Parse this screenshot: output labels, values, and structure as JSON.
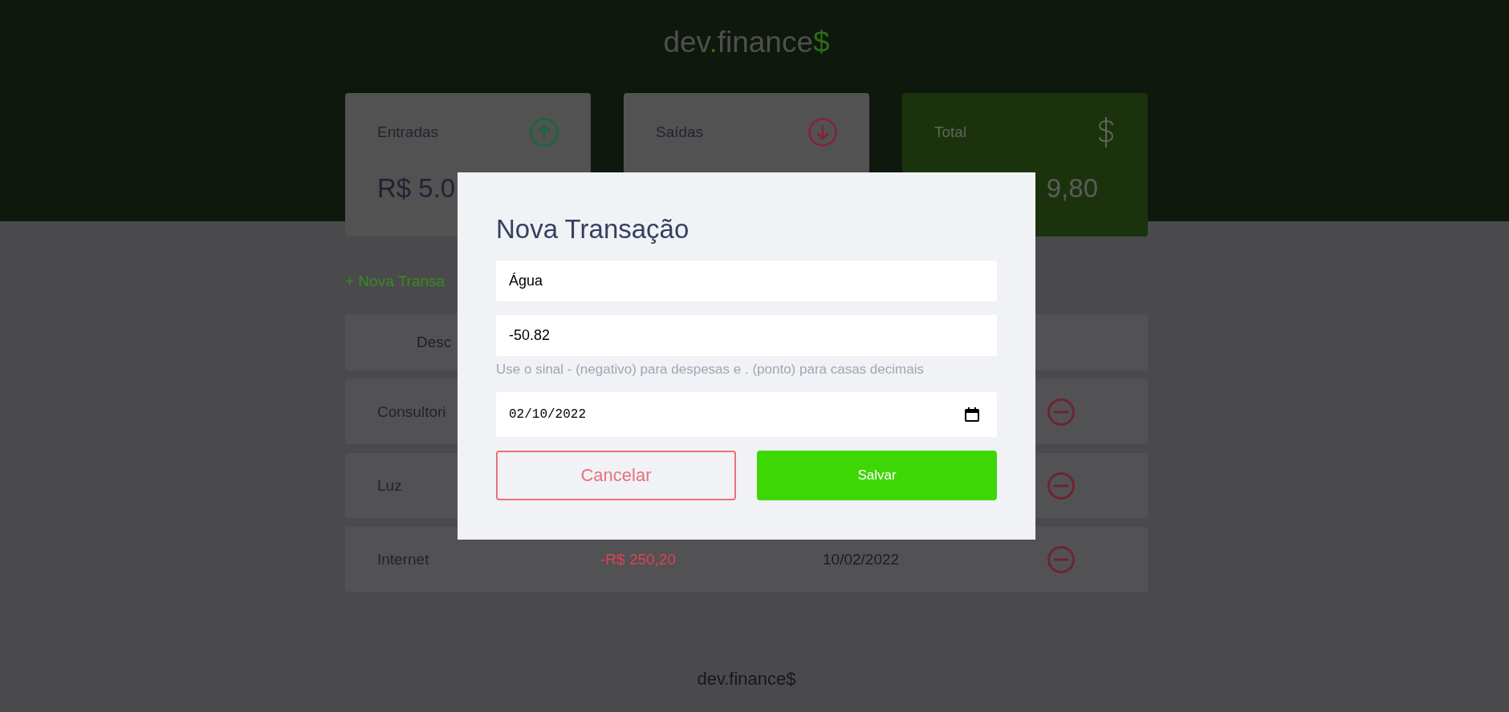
{
  "header": {
    "logo": [
      {
        "text": "dev",
        "accent": false
      },
      {
        "text": ".",
        "accent": true
      },
      {
        "text": "finance",
        "accent": false
      },
      {
        "text": "$",
        "accent": true
      }
    ]
  },
  "summary_cards": [
    {
      "kind": "income",
      "label": "Entradas",
      "value": "R$ 5.0"
    },
    {
      "kind": "expense",
      "label": "Saídas"
    },
    {
      "kind": "total",
      "label": "Total",
      "value": "9,80"
    }
  ],
  "new_transaction_link": "+ Nova Transa",
  "table": {
    "columns": [
      "Desc"
    ],
    "rows": [
      {
        "description": "Consultori"
      },
      {
        "description": "Luz"
      },
      {
        "description": "Internet",
        "amount": "-R$ 250,20",
        "date": "10/02/2022"
      }
    ]
  },
  "modal": {
    "title": "Nova Transação",
    "fields": [
      {
        "kind": "text",
        "value": "Água"
      },
      {
        "kind": "number",
        "value": "-50.82",
        "help": "Use o sinal - (negativo) para despesas e . (ponto) para casas decimais"
      },
      {
        "kind": "date",
        "value": "02/10/2022"
      }
    ],
    "buttons": [
      {
        "kind": "cancel",
        "label": "Cancelar"
      },
      {
        "kind": "save",
        "label": "Salvar"
      }
    ]
  },
  "footer": {
    "logo": "dev.finance$"
  }
}
